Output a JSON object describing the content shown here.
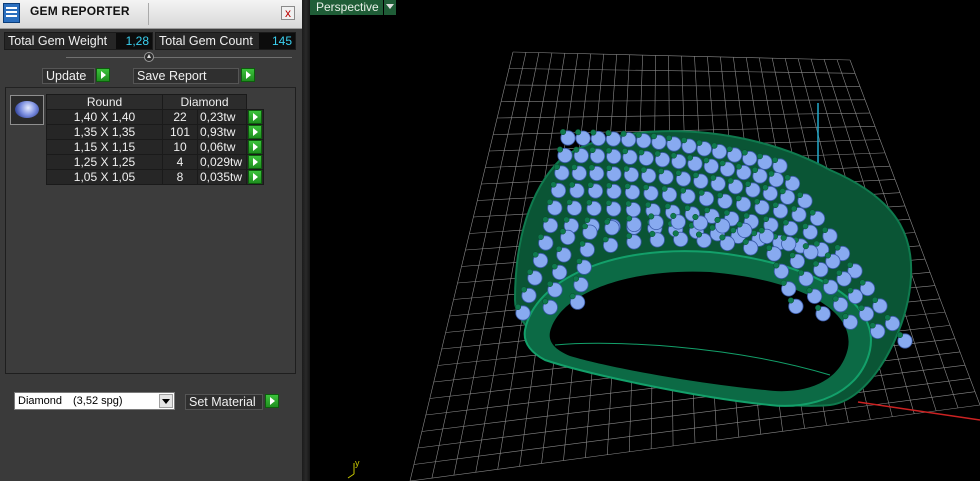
{
  "panel": {
    "title": "GEM REPORTER",
    "close_glyph": "x",
    "total_weight_label": "Total Gem Weight",
    "total_weight_value": "1,28",
    "total_count_label": "Total Gem Count",
    "total_count_value": "145",
    "update_label": "Update",
    "save_report_label": "Save Report",
    "table": {
      "col_shape": "Round",
      "col_material": "Diamond",
      "rows": [
        {
          "size": "1,40 X 1,40",
          "count": "22",
          "weight": "0,23tw"
        },
        {
          "size": "1,35 X 1,35",
          "count": "101",
          "weight": "0,93tw"
        },
        {
          "size": "1,15 X 1,15",
          "count": "10",
          "weight": "0,06tw"
        },
        {
          "size": "1,25 X 1,25",
          "count": "4",
          "weight": "0,029tw"
        },
        {
          "size": "1,05 X 1,05",
          "count": "8",
          "weight": "0,035tw"
        }
      ]
    },
    "material": {
      "name": "Diamond",
      "spg": "(3,52 spg)"
    },
    "set_material_label": "Set Material"
  },
  "viewport": {
    "tab_label": "Perspective",
    "axis_label": "y",
    "colors": {
      "grid": "#8a8a8a",
      "metal": "#0f7a4e",
      "gem": "#88aaf0",
      "y_axis": "#22aacc",
      "x_axis": "#cc2222"
    }
  }
}
